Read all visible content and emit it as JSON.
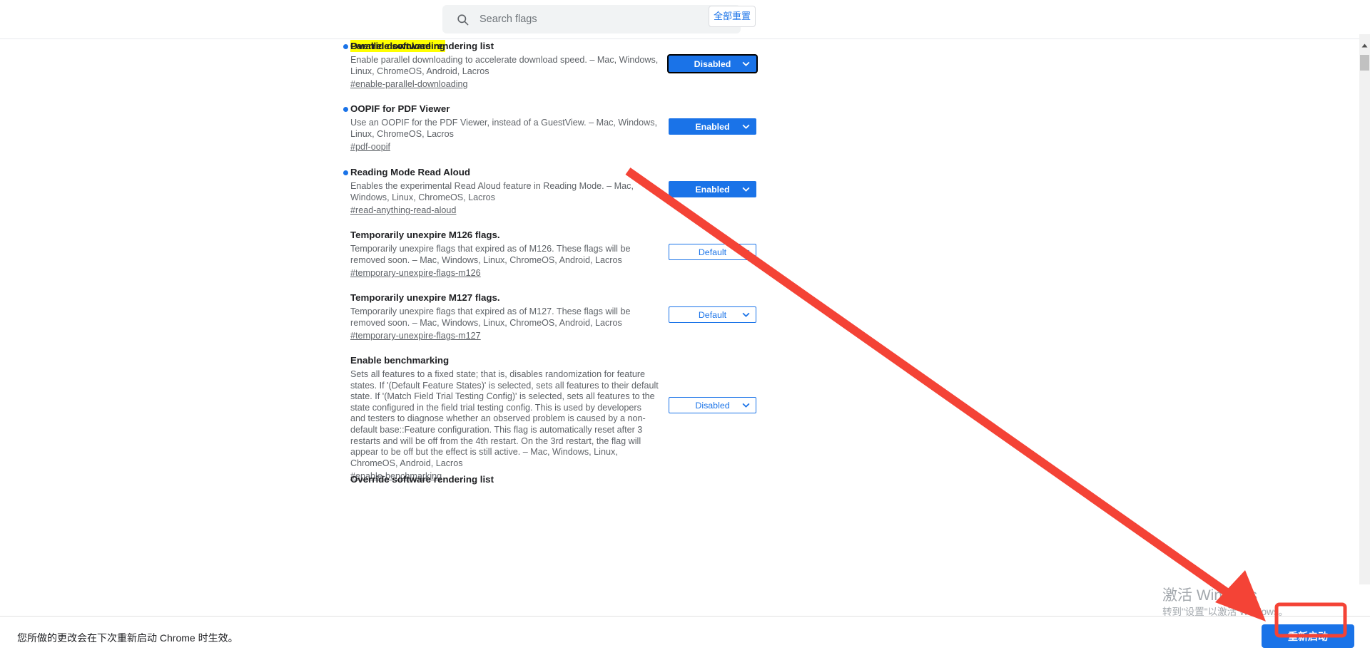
{
  "search": {
    "placeholder": "Search flags",
    "value": "",
    "icon": "search-icon"
  },
  "toolbar": {
    "reset_all_label": "全部重置"
  },
  "flags": [
    {
      "title": "Parallel downloading",
      "highlighted": true,
      "has_dot": true,
      "description": "Enable parallel downloading to accelerate download speed. – Mac, Windows, Linux, ChromeOS, Android, Lacros",
      "anchor": "#enable-parallel-downloading",
      "select_value": "Disabled",
      "select_style": "blue",
      "focused": true
    },
    {
      "title": "OOPIF for PDF Viewer",
      "highlighted": false,
      "has_dot": true,
      "description": "Use an OOPIF for the PDF Viewer, instead of a GuestView. – Mac, Windows, Linux, ChromeOS, Lacros",
      "anchor": "#pdf-oopif",
      "select_value": "Enabled",
      "select_style": "blue",
      "focused": false
    },
    {
      "title": "Reading Mode Read Aloud",
      "highlighted": false,
      "has_dot": true,
      "description": "Enables the experimental Read Aloud feature in Reading Mode. – Mac, Windows, Linux, ChromeOS, Lacros",
      "anchor": "#read-anything-read-aloud",
      "select_value": "Enabled",
      "select_style": "blue",
      "focused": false
    },
    {
      "title": "Temporarily unexpire M126 flags.",
      "highlighted": false,
      "has_dot": false,
      "description": "Temporarily unexpire flags that expired as of M126. These flags will be removed soon. – Mac, Windows, Linux, ChromeOS, Android, Lacros",
      "anchor": "#temporary-unexpire-flags-m126",
      "select_value": "Default",
      "select_style": "white",
      "focused": false
    },
    {
      "title": "Temporarily unexpire M127 flags.",
      "highlighted": false,
      "has_dot": false,
      "description": "Temporarily unexpire flags that expired as of M127. These flags will be removed soon. – Mac, Windows, Linux, ChromeOS, Android, Lacros",
      "anchor": "#temporary-unexpire-flags-m127",
      "select_value": "Default",
      "select_style": "white",
      "focused": false
    },
    {
      "title": "Enable benchmarking",
      "highlighted": false,
      "has_dot": false,
      "description": "Sets all features to a fixed state; that is, disables randomization for feature states. If '(Default Feature States)' is selected, sets all features to their default state. If '(Match Field Trial Testing Config)' is selected, sets all features to the state configured in the field trial testing config. This is used by developers and testers to diagnose whether an observed problem is caused by a non-default base::Feature configuration. This flag is automatically reset after 3 restarts and will be off from the 4th restart. On the 3rd restart, the flag will appear to be off but the effect is still active. – Mac, Windows, Linux, ChromeOS, Android, Lacros",
      "anchor": "#enable-benchmarking",
      "select_value": "Disabled",
      "select_style": "white",
      "focused": false
    },
    {
      "title": "Override software rendering list",
      "highlighted": false,
      "has_dot": false,
      "description": "",
      "anchor": "",
      "select_value": "",
      "select_style": "none",
      "focused": false
    }
  ],
  "select_options": [
    "Default",
    "Enabled",
    "Disabled"
  ],
  "restart_bar": {
    "note": "您所做的更改会在下次重新启动 Chrome 时生效。",
    "button_label": "重新启动"
  },
  "watermark": {
    "title": "激活 Windows",
    "subtitle": "转到\"设置\"以激活 Windows。"
  },
  "scrollbar": {
    "up_arrow": "scroll-up-arrow-icon"
  },
  "annotations": {
    "arrow_color": "#f44336",
    "highlight_box_color": "#f44336",
    "highlight_color": "#ffff00"
  }
}
